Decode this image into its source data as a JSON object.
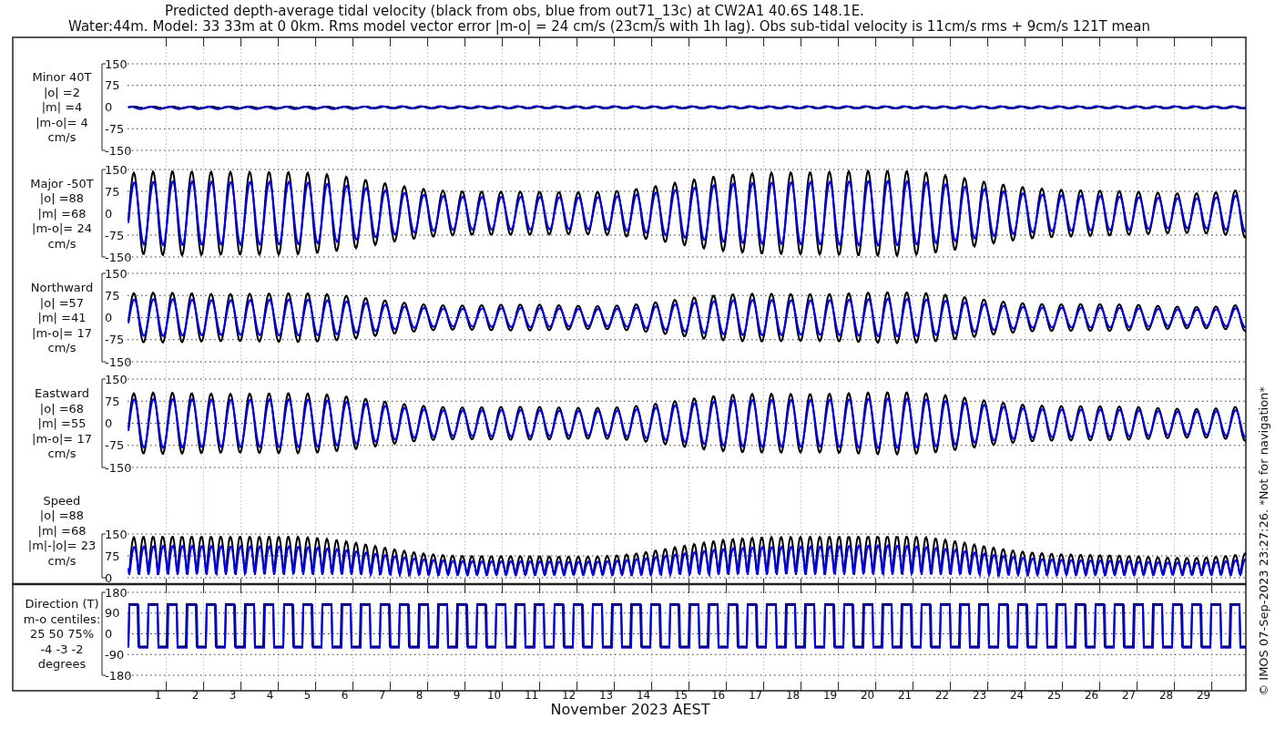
{
  "title_lines": [
    "Predicted depth-average tidal velocity (black from obs, blue from out71_13c) at CW2A1 40.6S 148.1E.",
    "Water:44m. Model: 33 33m at 0 0km. Rms model vector error |m-o| = 24 cm/s (23cm/s with 1h lag). Obs sub-tidal velocity is 11cm/s rms + 9cm/s 121T mean"
  ],
  "panels": [
    {
      "kind": "velocity",
      "label_lines": [
        "Minor 40T",
        "|o| =2",
        "|m| =4",
        "|m-o|= 4",
        "cm/s"
      ],
      "y_tick_labels": [
        "150",
        "75",
        "0",
        "-75",
        "-150"
      ]
    },
    {
      "kind": "velocity",
      "label_lines": [
        "Major -50T",
        "|o| =88",
        "|m| =68",
        "|m-o|= 24",
        "cm/s"
      ],
      "y_tick_labels": [
        "150",
        "75",
        "0",
        "-75",
        "-150"
      ]
    },
    {
      "kind": "velocity",
      "label_lines": [
        "Northward",
        "|o| =57",
        "|m| =41",
        "|m-o|= 17",
        "cm/s"
      ],
      "y_tick_labels": [
        "150",
        "75",
        "0",
        "-75",
        "-150"
      ]
    },
    {
      "kind": "velocity",
      "label_lines": [
        "Eastward",
        "|o| =68",
        "|m| =55",
        "|m-o|= 17",
        "cm/s"
      ],
      "y_tick_labels": [
        "150",
        "75",
        "0",
        "-75",
        "-150"
      ]
    },
    {
      "kind": "speed",
      "label_lines": [
        "Speed",
        "|o| =88",
        "|m| =68",
        "|m|-|o|= 23",
        "cm/s"
      ],
      "y_tick_labels": [
        "150",
        "75",
        "0"
      ]
    },
    {
      "kind": "direction",
      "label_lines": [
        "Direction (T)",
        "m-o centiles:",
        "25  50  75%",
        "-4 -3 -2",
        "degrees"
      ],
      "y_tick_labels": [
        "180",
        "90",
        "0",
        "-90",
        "-180"
      ]
    }
  ],
  "x_tick_labels": [
    "1",
    "2",
    "3",
    "4",
    "5",
    "6",
    "7",
    "8",
    "9",
    "10",
    "11",
    "12",
    "13",
    "14",
    "15",
    "16",
    "17",
    "18",
    "19",
    "20",
    "21",
    "22",
    "23",
    "24",
    "25",
    "26",
    "27",
    "28",
    "29"
  ],
  "x_axis_title": "November 2023 AEST",
  "credit": "© IMOS 07-Sep-2023 23:27:26. *Not for navigation*"
}
